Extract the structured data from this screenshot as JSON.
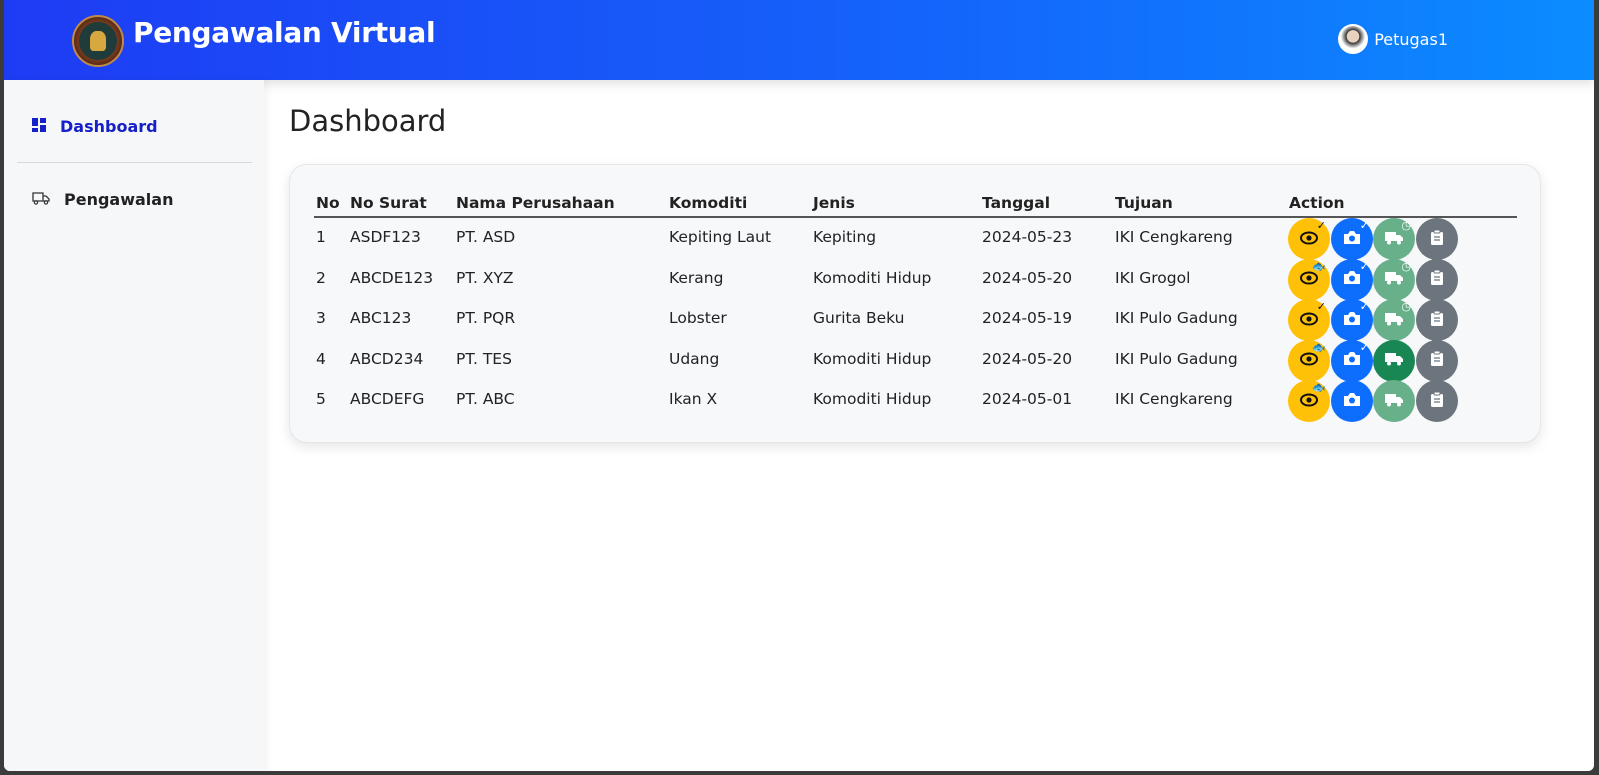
{
  "header": {
    "title": "Pengawalan Virtual",
    "user": "Petugas1"
  },
  "sidebar": {
    "items": [
      {
        "label": "Dashboard",
        "icon": "dashboard-icon",
        "active": true
      },
      {
        "label": "Pengawalan",
        "icon": "truck-icon",
        "active": false
      }
    ]
  },
  "main": {
    "title": "Dashboard"
  },
  "table": {
    "columns": [
      "No",
      "No Surat",
      "Nama Perusahaan",
      "Komoditi",
      "Jenis",
      "Tanggal",
      "Tujuan",
      "Action"
    ],
    "rows": [
      {
        "no": "1",
        "no_surat": "ASDF123",
        "perusahaan": "PT. ASD",
        "komoditi": "Kepiting Laut",
        "jenis": "Kepiting",
        "tanggal": "2024-05-23",
        "tujuan": "IKI Cengkareng",
        "view_badge": "check",
        "photo_badge": "check",
        "ship_state": "pending"
      },
      {
        "no": "2",
        "no_surat": "ABCDE123",
        "perusahaan": "PT. XYZ",
        "komoditi": "Kerang",
        "jenis": "Komoditi Hidup",
        "tanggal": "2024-05-20",
        "tujuan": "IKI Grogol",
        "view_badge": "fish",
        "photo_badge": "check",
        "ship_state": "pending"
      },
      {
        "no": "3",
        "no_surat": "ABC123",
        "perusahaan": "PT. PQR",
        "komoditi": "Lobster",
        "jenis": "Gurita Beku",
        "tanggal": "2024-05-19",
        "tujuan": "IKI Pulo Gadung",
        "view_badge": "check",
        "photo_badge": "check",
        "ship_state": "pending"
      },
      {
        "no": "4",
        "no_surat": "ABCD234",
        "perusahaan": "PT. TES",
        "komoditi": "Udang",
        "jenis": "Komoditi Hidup",
        "tanggal": "2024-05-20",
        "tujuan": "IKI Pulo Gadung",
        "view_badge": "fish",
        "photo_badge": "check",
        "ship_state": "done"
      },
      {
        "no": "5",
        "no_surat": "ABCDEFG",
        "perusahaan": "PT. ABC",
        "komoditi": "Ikan X",
        "jenis": "Komoditi Hidup",
        "tanggal": "2024-05-01",
        "tujuan": "IKI Cengkareng",
        "view_badge": "fish",
        "photo_badge": "none",
        "ship_state": "idle"
      }
    ]
  },
  "colors": {
    "view": "#ffc107",
    "photo": "#0d6efd",
    "ship_idle": "#68b08a",
    "ship_done": "#198754",
    "report": "#6c757d"
  }
}
